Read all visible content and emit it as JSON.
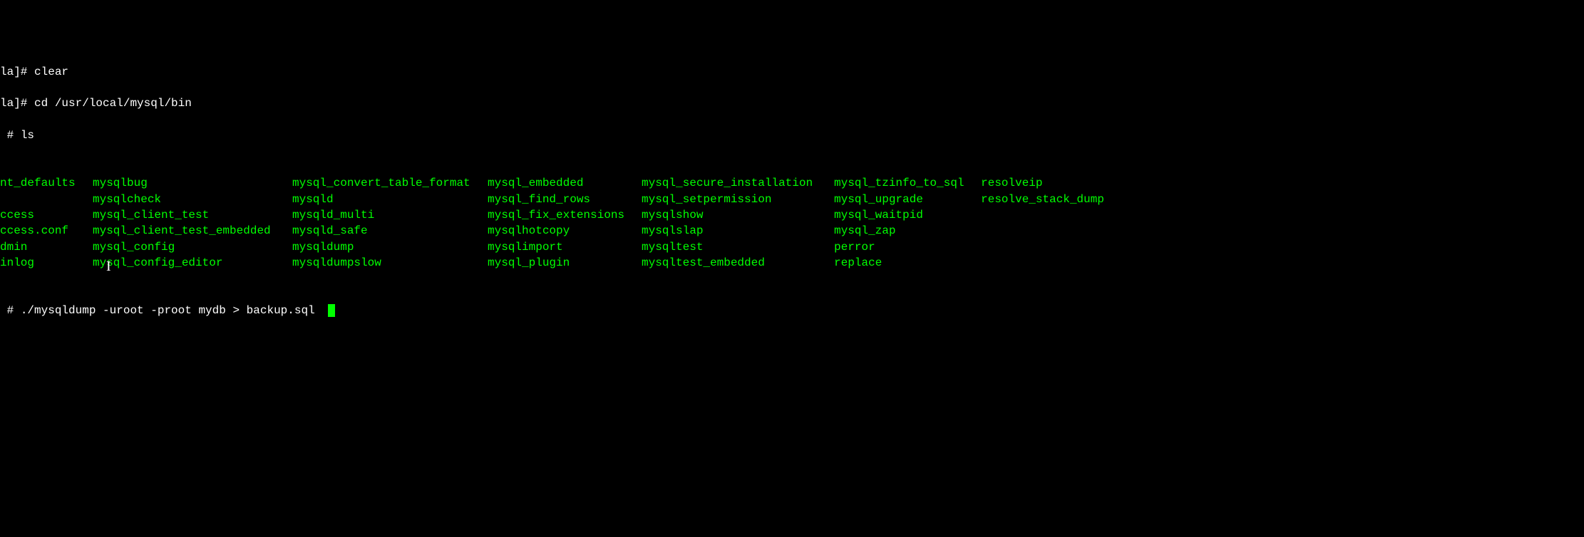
{
  "lines": {
    "l1_prompt": "la]# ",
    "l1_cmd": "clear",
    "l2_prompt": "la]# ",
    "l2_cmd": "cd /usr/local/mysql/bin",
    "l3_prompt": " # ",
    "l3_cmd": "ls",
    "last_prompt": " # ",
    "last_cmd": "./mysqldump -uroot -proot mydb > backup.sql"
  },
  "ls": {
    "col0": [
      "nt_defaults",
      "",
      "ccess",
      "ccess.conf",
      "dmin",
      "inlog"
    ],
    "col1": [
      "mysqlbug",
      "mysqlcheck",
      "mysql_client_test",
      "mysql_client_test_embedded",
      "mysql_config",
      "mysql_config_editor"
    ],
    "col2": [
      "mysql_convert_table_format",
      "mysqld",
      "mysqld_multi",
      "mysqld_safe",
      "mysqldump",
      "mysqldumpslow"
    ],
    "col3": [
      "mysql_embedded",
      "mysql_find_rows",
      "mysql_fix_extensions",
      "mysqlhotcopy",
      "mysqlimport",
      "mysql_plugin"
    ],
    "col4": [
      "mysql_secure_installation",
      "mysql_setpermission",
      "mysqlshow",
      "mysqlslap",
      "mysqltest",
      "mysqltest_embedded"
    ],
    "col5": [
      "mysql_tzinfo_to_sql",
      "mysql_upgrade",
      "mysql_waitpid",
      "mysql_zap",
      "perror",
      "replace"
    ],
    "col6": [
      "resolveip",
      "resolve_stack_dump",
      "",
      "",
      "",
      ""
    ]
  }
}
